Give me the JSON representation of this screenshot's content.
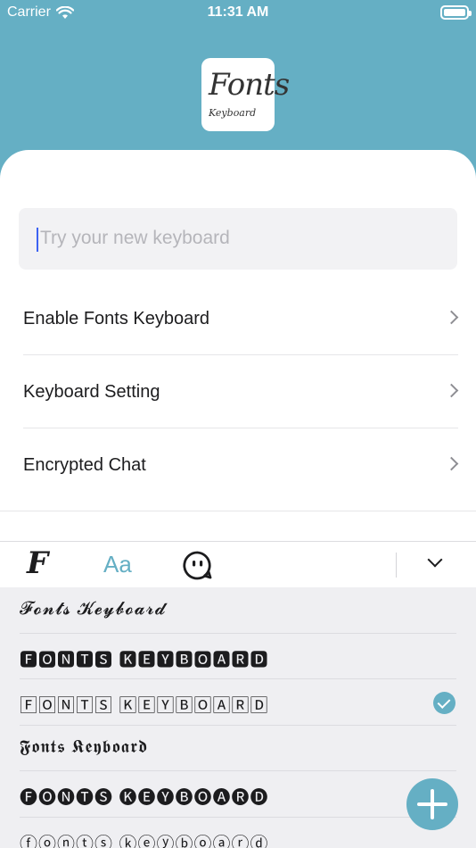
{
  "status_bar": {
    "carrier": "Carrier",
    "time": "11:31 AM"
  },
  "app": {
    "logo_title": "Fonts",
    "logo_subtitle": "Keyboard"
  },
  "search": {
    "placeholder": "Try your new keyboard"
  },
  "menu": [
    {
      "label": "Enable Fonts Keyboard"
    },
    {
      "label": "Keyboard Setting"
    },
    {
      "label": "Encrypted Chat"
    }
  ],
  "toolbar": {
    "font_tab": "F",
    "style_tab": "Aa"
  },
  "fonts": [
    {
      "sample": "𝓕𝓸𝓷𝓽𝓼 𝓚𝓮𝔂𝓫𝓸𝓪𝓻𝓭",
      "selected": false
    },
    {
      "sample": "🅵🅾🅽🆃🆂 🅺🅴🆈🅱🅾🅰🆁🅳",
      "selected": false
    },
    {
      "sample": "🄵🄾🄽🅃🅂 🄺🄴🅈🄱🄾🄰🅁🄳",
      "selected": true
    },
    {
      "sample": "𝕱𝖔𝖓𝖙𝖘 𝕶𝖊𝖞𝖇𝖔𝖆𝖗𝖉",
      "selected": false
    },
    {
      "sample": "🅕🅞🅝🅣🅢 🅚🅔🅨🅑🅞🅐🅡🅓",
      "selected": false
    },
    {
      "sample": "ⓕⓞⓝⓣⓢ ⓚⓔⓨⓑⓞⓐⓡⓓ",
      "selected": false
    }
  ],
  "colors": {
    "accent": "#65afc4",
    "caret": "#3c62f2"
  }
}
